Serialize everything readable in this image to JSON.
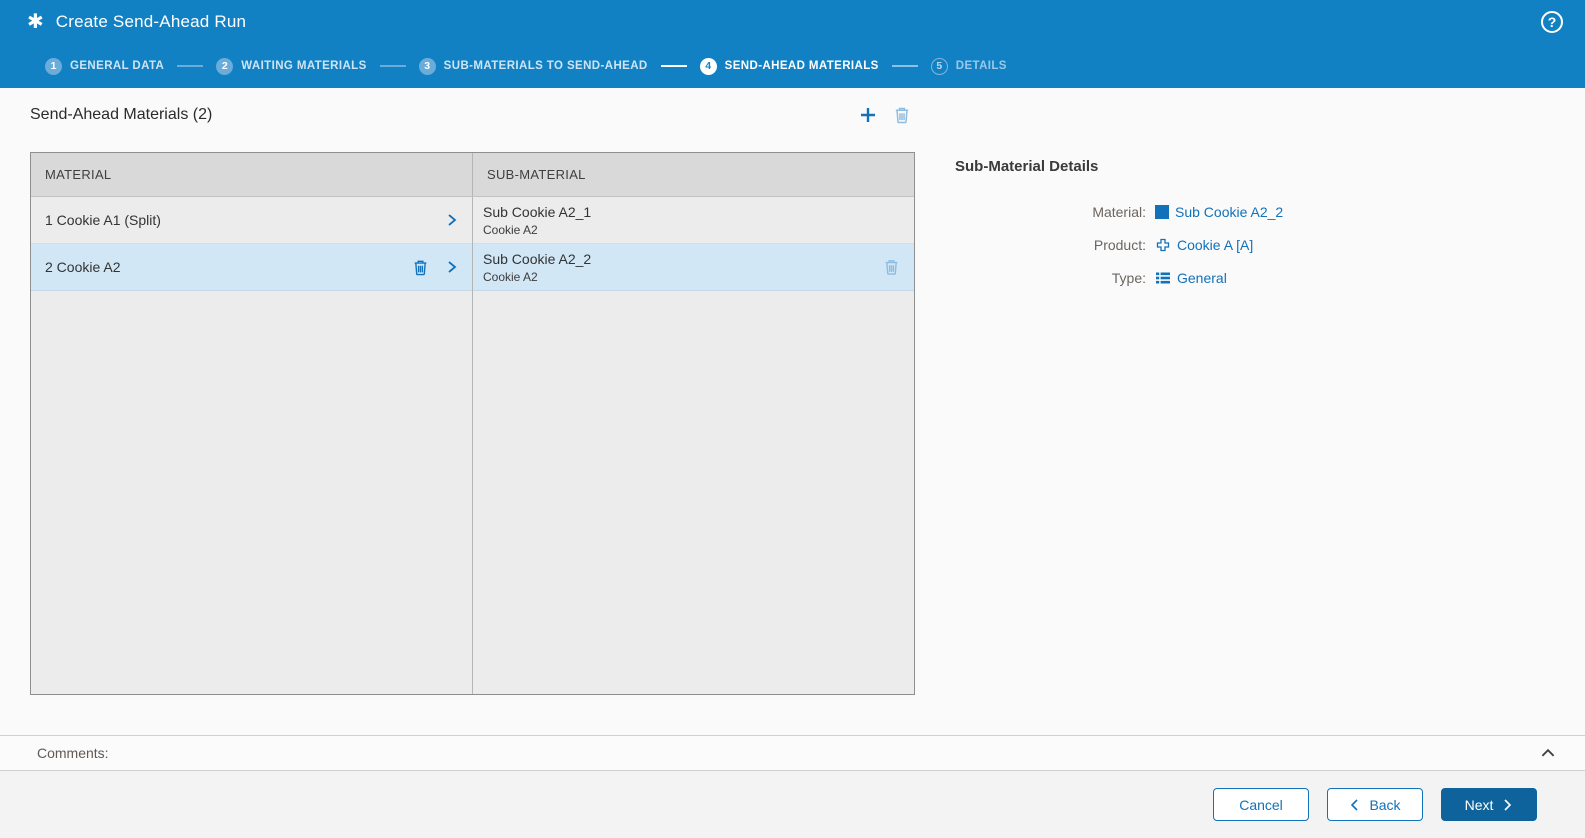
{
  "colors": {
    "header_blue": "#1181c4",
    "accent_blue": "#1272b9",
    "primary_button_blue": "#0f639d",
    "selected_row_blue": "#d2e7f6",
    "row_gray": "#ececec",
    "table_header_gray": "#d9d9d9"
  },
  "header": {
    "title": "Create Send-Ahead Run",
    "help_icon": "?"
  },
  "stepper": {
    "steps": [
      {
        "number": "1",
        "label": "GENERAL DATA",
        "state": "completed"
      },
      {
        "number": "2",
        "label": "WAITING MATERIALS",
        "state": "completed"
      },
      {
        "number": "3",
        "label": "SUB-MATERIALS TO SEND-AHEAD",
        "state": "completed"
      },
      {
        "number": "4",
        "label": "SEND-AHEAD MATERIALS",
        "state": "active"
      },
      {
        "number": "5",
        "label": "DETAILS",
        "state": "upcoming"
      }
    ]
  },
  "materials_section": {
    "title": "Send-Ahead Materials (2)",
    "columns": [
      "MATERIAL",
      "SUB-MATERIAL"
    ],
    "materials": [
      {
        "label": "1 Cookie A1 (Split)",
        "selected": false
      },
      {
        "label": "2 Cookie A2",
        "selected": true
      }
    ],
    "sub_materials": [
      {
        "label": "Sub Cookie A2_1",
        "sublabel": "Cookie A2",
        "selected": false
      },
      {
        "label": "Sub Cookie A2_2",
        "sublabel": "Cookie A2",
        "selected": true
      }
    ]
  },
  "details_panel": {
    "title": "Sub-Material Details",
    "fields": [
      {
        "label": "Material:",
        "value": "Sub Cookie A2_2"
      },
      {
        "label": "Product:",
        "value": "Cookie A [A]"
      },
      {
        "label": "Type:",
        "value": "General"
      }
    ]
  },
  "comments": {
    "label": "Comments:"
  },
  "footer": {
    "cancel_label": "Cancel",
    "back_label": "Back",
    "next_label": "Next"
  }
}
